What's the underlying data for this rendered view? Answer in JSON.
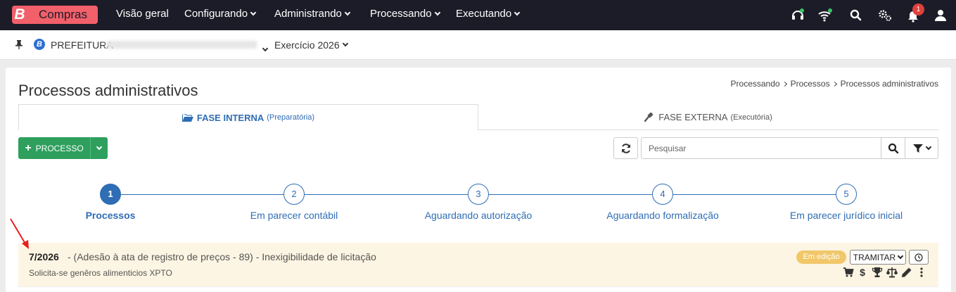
{
  "app": {
    "logo_letter": "B",
    "logo_text": "Compras"
  },
  "nav": {
    "items": [
      {
        "label": "Visão geral",
        "has_dropdown": false
      },
      {
        "label": "Configurando",
        "has_dropdown": true
      },
      {
        "label": "Administrando",
        "has_dropdown": true
      },
      {
        "label": "Processando",
        "has_dropdown": true
      },
      {
        "label": "Executando",
        "has_dropdown": true
      }
    ],
    "notification_count": "1",
    "icons": [
      "headset-icon",
      "wifi-icon",
      "search-icon",
      "settings-icon",
      "bell-icon",
      "user-icon"
    ]
  },
  "context": {
    "org_badge": "B",
    "org_name": "PREFEITURA",
    "exercise": "Exercício 2026"
  },
  "page": {
    "title": "Processos administrativos",
    "breadcrumb": [
      "Processando",
      "Processos",
      "Processos administrativos"
    ]
  },
  "tabs": [
    {
      "label": "FASE INTERNA",
      "sub": "(Preparatória)",
      "active": true,
      "icon": "folder-open-icon"
    },
    {
      "label": "FASE EXTERNA",
      "sub": "(Executória)",
      "active": false,
      "icon": "gavel-icon"
    }
  ],
  "toolbar": {
    "new_label": "PROCESSO",
    "search_placeholder": "Pesquisar"
  },
  "steps": [
    {
      "num": "1",
      "label": "Processos",
      "active": true
    },
    {
      "num": "2",
      "label": "Em parecer contábil",
      "active": false
    },
    {
      "num": "3",
      "label": "Aguardando autorização",
      "active": false
    },
    {
      "num": "4",
      "label": "Aguardando formalização",
      "active": false
    },
    {
      "num": "5",
      "label": "Em parecer jurídico inicial",
      "active": false
    }
  ],
  "process": {
    "number": "7/2026",
    "description": "- (Adesão à ata de registro de preços - 89) - Inexigibilidade de licitação",
    "subtitle": "Solicita-se genêros alimenticios XPTO",
    "status": "Em edição",
    "action_label": "TRAMITAR"
  },
  "colors": {
    "nav_bg": "#1c1c28",
    "logo_bg": "#f2606a",
    "primary": "#2f6db5",
    "success": "#2e9f5d",
    "warning_badge": "#f1c769",
    "row_highlight": "#fdf5e3"
  }
}
